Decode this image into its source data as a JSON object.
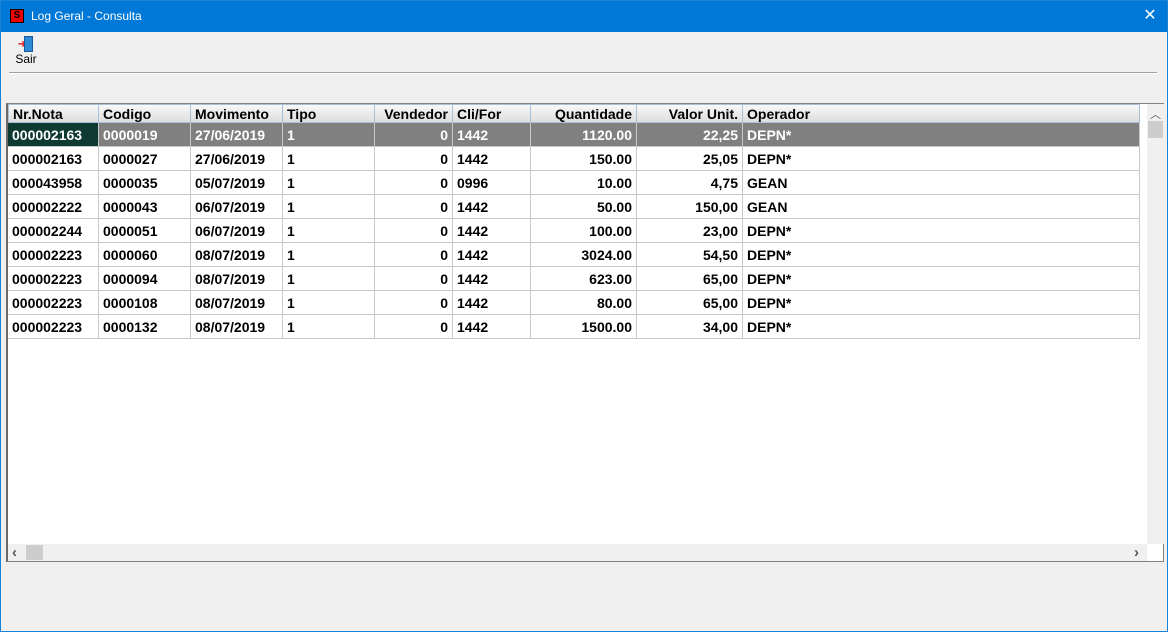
{
  "window": {
    "title": "Log Geral - Consulta",
    "close": "✕",
    "icon_letter": "S"
  },
  "toolbar": {
    "exit_label": "Sair"
  },
  "grid": {
    "columns": [
      "Nr.Nota",
      "Codigo",
      "Movimento",
      "Tipo",
      "Vendedor",
      "Cli/For",
      "Quantidade",
      "Valor Unit.",
      "Operador"
    ],
    "rows": [
      [
        "000002163",
        "0000019",
        "27/06/2019",
        "1",
        "0",
        "1442",
        "1120.00",
        "22,25",
        "DEPN*"
      ],
      [
        "000002163",
        "0000027",
        "27/06/2019",
        "1",
        "0",
        "1442",
        "150.00",
        "25,05",
        "DEPN*"
      ],
      [
        "000043958",
        "0000035",
        "05/07/2019",
        "1",
        "0",
        "0996",
        "10.00",
        "4,75",
        "GEAN"
      ],
      [
        "000002222",
        "0000043",
        "06/07/2019",
        "1",
        "0",
        "1442",
        "50.00",
        "150,00",
        "GEAN"
      ],
      [
        "000002244",
        "0000051",
        "06/07/2019",
        "1",
        "0",
        "1442",
        "100.00",
        "23,00",
        "DEPN*"
      ],
      [
        "000002223",
        "0000060",
        "08/07/2019",
        "1",
        "0",
        "1442",
        "3024.00",
        "54,50",
        "DEPN*"
      ],
      [
        "000002223",
        "0000094",
        "08/07/2019",
        "1",
        "0",
        "1442",
        "623.00",
        "65,00",
        "DEPN*"
      ],
      [
        "000002223",
        "0000108",
        "08/07/2019",
        "1",
        "0",
        "1442",
        "80.00",
        "65,00",
        "DEPN*"
      ],
      [
        "000002223",
        "0000132",
        "08/07/2019",
        "1",
        "0",
        "1442",
        "1500.00",
        "34,00",
        "DEPN*"
      ]
    ],
    "selected_row": 0,
    "scroll": {
      "up": "︿",
      "left": "‹",
      "right": "›"
    }
  }
}
